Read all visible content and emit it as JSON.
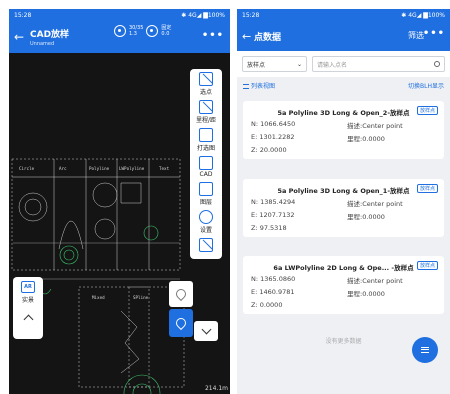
{
  "phone1": {
    "status": {
      "time": "15:28",
      "right": "✱ 4G◢ ▇100%"
    },
    "header": {
      "title": "CAD放样",
      "subtitle": "Unnamed",
      "stat1": [
        "30/35",
        "1.3"
      ],
      "stat2": [
        "固定",
        "0.0"
      ]
    },
    "toolbar": [
      {
        "label": "选点"
      },
      {
        "label": "里程/距"
      },
      {
        "label": "打选图"
      },
      {
        "label": "CAD"
      },
      {
        "label": "图层"
      },
      {
        "label": "设置"
      }
    ],
    "left_panel": {
      "ar": "AR",
      "label": "实景"
    },
    "cad_texts": [
      "Circle",
      "Arc",
      "Polyline",
      "LWPolyline",
      "Text",
      "Mixed",
      "SPline"
    ],
    "scale": "214.1m"
  },
  "phone2": {
    "status": {
      "time": "15:28",
      "right": "✱ 4G◢ ▇100%"
    },
    "header": {
      "title": "点数据",
      "filter": "筛选"
    },
    "search": {
      "select": "放样点",
      "placeholder": "请输入点名"
    },
    "view": {
      "list_view": "列表视图",
      "switch": "切换BLH显示"
    },
    "cards": [
      {
        "title": "5a Polyline 3D Long & Open_2-放样点",
        "badge": "放样点",
        "n": "N:  1066.6450",
        "e": "E:  1301.2282",
        "z": "Z:  20.0000",
        "desc": "描述:Center point",
        "mile": "里程:0.0000"
      },
      {
        "title": "5a Polyline 3D Long & Open_1-放样点",
        "badge": "放样点",
        "n": "N:  1385.4294",
        "e": "E:  1207.7132",
        "z": "Z:  97.5318",
        "desc": "描述:Center point",
        "mile": "里程:0.0000"
      },
      {
        "title": "6a LWPolyline 2D Long & Ope... -放样点",
        "badge": "放样点",
        "n": "N:  1365.0860",
        "e": "E:  1460.9781",
        "z": "Z:  0.0000",
        "desc": "描述:Center point",
        "mile": "里程:0.0000"
      }
    ],
    "no_more": "没有更多数据"
  }
}
